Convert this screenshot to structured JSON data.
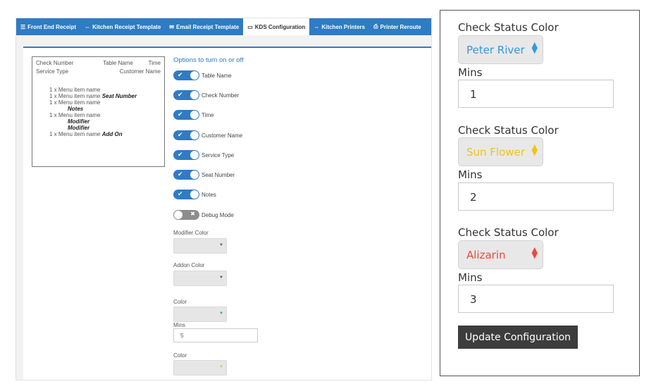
{
  "tabs": [
    {
      "icon": "☰",
      "label": "Front End Receipt"
    },
    {
      "icon": "⇔",
      "label": "Kitchen Receipt Template"
    },
    {
      "icon": "✉",
      "label": "Email Receipt Template"
    },
    {
      "icon": "▭",
      "label": "KDS Configuration"
    },
    {
      "icon": "⇔",
      "label": "Kitchen Printers"
    },
    {
      "icon": "⎙",
      "label": "Printer Reroute"
    }
  ],
  "preview": {
    "check_number": "Check Number",
    "table_name": "Table Name",
    "time": "Time",
    "service_type": "Service Type",
    "customer_name": "Customer Name",
    "items": [
      {
        "text": "1 x Menu item name",
        "extra": ""
      },
      {
        "text": "1 x Menu item name",
        "extra": "Seat Number"
      },
      {
        "text": "1 x Menu item name",
        "extra": ""
      },
      {
        "text": "",
        "extra": "Notes"
      },
      {
        "text": "1 x Menu item name",
        "extra": ""
      },
      {
        "text": "",
        "extra": "Modifier"
      },
      {
        "text": "",
        "extra": "Modifier"
      },
      {
        "text": "1 x Menu item name",
        "extra": "Add On"
      }
    ]
  },
  "options": {
    "title": "Options to turn on or off",
    "toggles": [
      {
        "label": "Table Name",
        "on": true
      },
      {
        "label": "Check Number",
        "on": true
      },
      {
        "label": "Time",
        "on": true
      },
      {
        "label": "Customer Name",
        "on": true
      },
      {
        "label": "Service Type",
        "on": true
      },
      {
        "label": "Seat Number",
        "on": true
      },
      {
        "label": "Notes",
        "on": true
      },
      {
        "label": "Debug Mode",
        "on": false
      }
    ],
    "modifier_color_label": "Modifier Color",
    "addon_color_label": "Addon Color",
    "color_label": "Color",
    "mins_label": "Mins",
    "mins_value": "5",
    "color2_label": "Color",
    "arrow_colors": {
      "modifier": "#555555",
      "addon": "#555555",
      "color1": "#27ae60",
      "color2": "#f1c40f"
    }
  },
  "right": {
    "entries": [
      {
        "label": "Check Status Color",
        "color_name": "Peter River",
        "color_hex": "#3498db",
        "mins_label": "Mins",
        "mins_value": "1"
      },
      {
        "label": "Check Status Color",
        "color_name": "Sun Flower",
        "color_hex": "#f1c40f",
        "mins_label": "Mins",
        "mins_value": "2"
      },
      {
        "label": "Check Status Color",
        "color_name": "Alizarin",
        "color_hex": "#e74c3c",
        "mins_label": "Mins",
        "mins_value": "3"
      }
    ],
    "button_label": "Update Configuration"
  }
}
